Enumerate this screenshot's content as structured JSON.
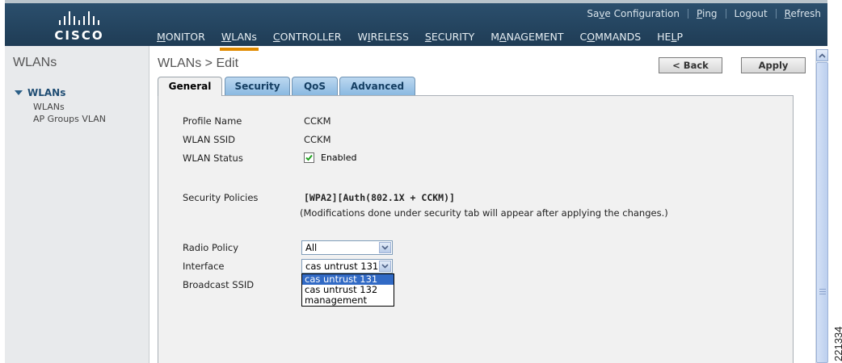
{
  "brand": {
    "logo_text": "CISCO"
  },
  "header": {
    "util_links": [
      "Save Configuration",
      "Ping",
      "Logout",
      "Refresh"
    ],
    "nav": [
      {
        "label": "MONITOR",
        "active": false
      },
      {
        "label": "WLANs",
        "active": true
      },
      {
        "label": "CONTROLLER",
        "active": false
      },
      {
        "label": "WIRELESS",
        "active": false
      },
      {
        "label": "SECURITY",
        "active": false
      },
      {
        "label": "MANAGEMENT",
        "active": false
      },
      {
        "label": "COMMANDS",
        "active": false
      },
      {
        "label": "HELP",
        "active": false
      }
    ]
  },
  "sidebar": {
    "title": "WLANs",
    "section": "WLANs",
    "items": [
      "WLANs",
      "AP Groups VLAN"
    ]
  },
  "page": {
    "title": "WLANs > Edit",
    "back_label": "< Back",
    "apply_label": "Apply"
  },
  "tabs": [
    {
      "label": "General",
      "active": true
    },
    {
      "label": "Security",
      "active": false
    },
    {
      "label": "QoS",
      "active": false
    },
    {
      "label": "Advanced",
      "active": false
    }
  ],
  "form": {
    "profile_name_label": "Profile Name",
    "profile_name": "CCKM",
    "wlan_ssid_label": "WLAN SSID",
    "wlan_ssid": "CCKM",
    "wlan_status_label": "WLAN Status",
    "wlan_status_checked": true,
    "wlan_status_text": "Enabled",
    "security_policies_label": "Security Policies",
    "security_policies": "[WPA2][Auth(802.1X + CCKM)]",
    "security_note": "(Modifications done under security tab will appear after applying the changes.)",
    "radio_policy_label": "Radio Policy",
    "radio_policy": "All",
    "interface_label": "Interface",
    "interface": "cas untrust 131",
    "interface_options": [
      "cas untrust 131",
      "cas untrust 132",
      "management"
    ],
    "broadcast_ssid_label": "Broadcast SSID"
  },
  "figure_id": "221334"
}
